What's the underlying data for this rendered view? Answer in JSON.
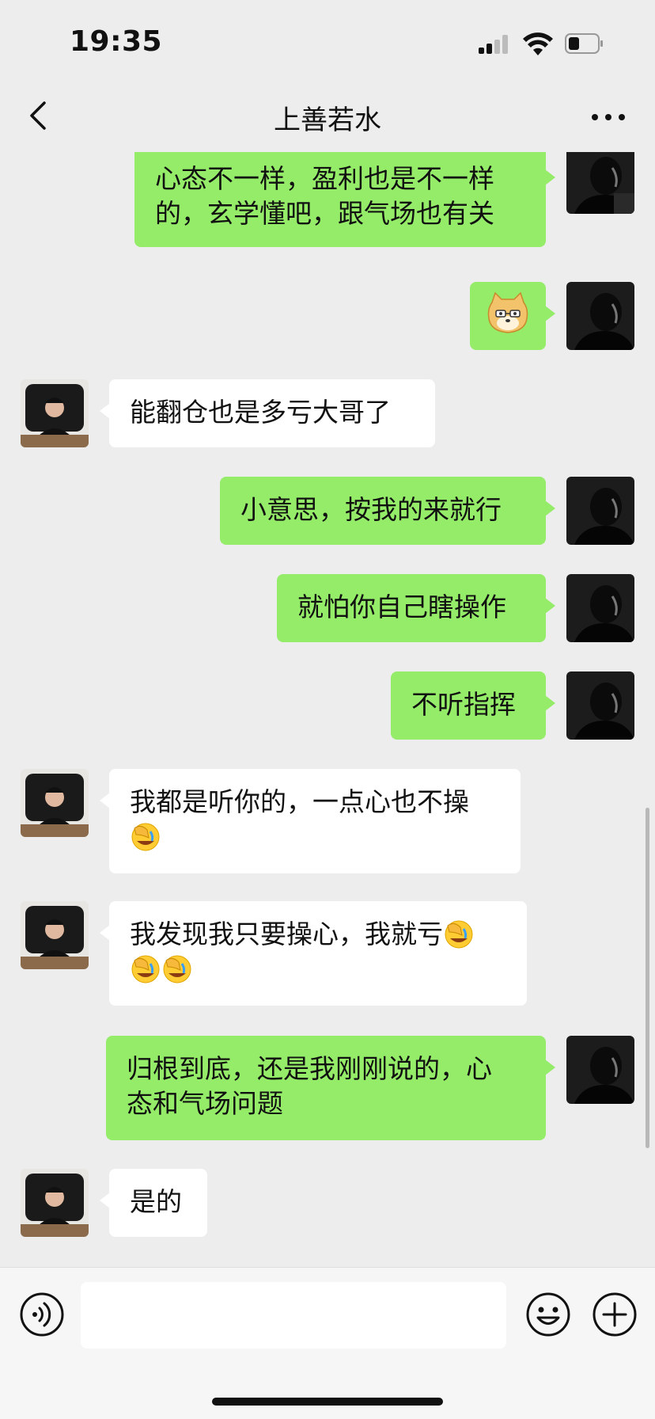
{
  "status_bar": {
    "time": "19:35"
  },
  "nav": {
    "title": "上善若水",
    "back_icon": "chevron-left-icon",
    "more_icon": "more-dots-icon"
  },
  "colors": {
    "self_bubble": "#95ec69",
    "other_bubble": "#ffffff",
    "background": "#ededed"
  },
  "messages": [
    {
      "sender": "me",
      "lines": [
        "心态不一样，盈利也是不一样",
        "的，玄学懂吧，跟气场也有关"
      ]
    },
    {
      "sender": "me",
      "sticker": "doge-face-emoji"
    },
    {
      "sender": "other",
      "lines": [
        "能翻仓也是多亏大哥了"
      ]
    },
    {
      "sender": "me",
      "lines": [
        "小意思，按我的来就行"
      ]
    },
    {
      "sender": "me",
      "lines": [
        "就怕你自己瞎操作"
      ]
    },
    {
      "sender": "me",
      "lines": [
        "不听指挥"
      ]
    },
    {
      "sender": "other",
      "lines": [
        "我都是听你的，一点心也不操"
      ],
      "trailing_emojis": [
        "facepalm-emoji"
      ]
    },
    {
      "sender": "other",
      "lines": [
        "我发现我只要操心，我就亏"
      ],
      "trailing_emojis": [
        "facepalm-emoji",
        "facepalm-emoji",
        "facepalm-emoji"
      ]
    },
    {
      "sender": "me",
      "lines": [
        "归根到底，还是我刚刚说的，心",
        "态和气场问题"
      ]
    },
    {
      "sender": "other",
      "lines": [
        "是的"
      ]
    }
  ],
  "input_bar": {
    "placeholder": "",
    "voice_icon": "voice-icon",
    "emoji_icon": "emoji-icon",
    "plus_icon": "plus-icon"
  }
}
